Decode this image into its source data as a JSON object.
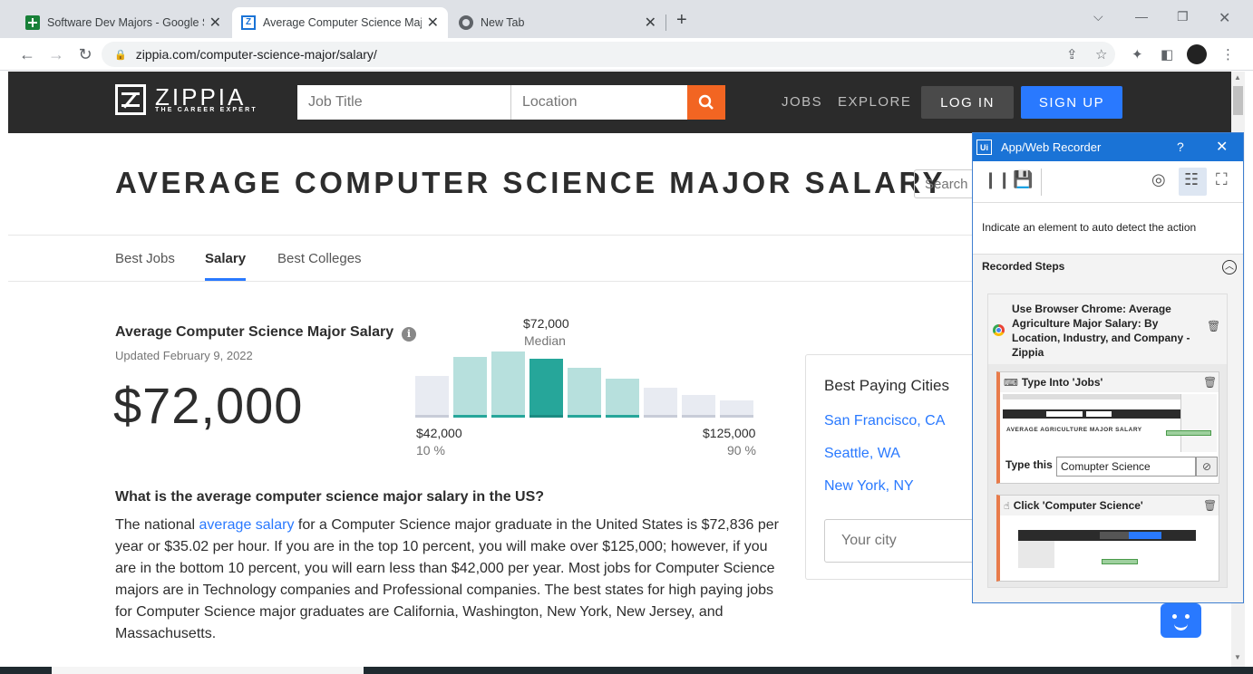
{
  "browser": {
    "tabs": [
      {
        "label": "Software Dev Majors - Google Sh",
        "icon": "sheets-icon"
      },
      {
        "label": "Average Computer Science Majo",
        "icon": "zippia-icon"
      },
      {
        "label": "New Tab",
        "icon": "chrome-icon"
      }
    ],
    "url": "zippia.com/computer-science-major/salary/"
  },
  "zippia": {
    "logo_name": "ZIPPIA",
    "logo_tagline": "THE CAREER EXPERT",
    "job_placeholder": "Job Title",
    "location_placeholder": "Location",
    "nav": [
      "JOBS",
      "EXPLORE"
    ],
    "login": "LOG IN",
    "signup": "SIGN UP",
    "page_title": "AVERAGE COMPUTER SCIENCE MAJOR SALARY",
    "search_placeholder": "Search F",
    "tabs": [
      "Best Jobs",
      "Salary",
      "Best Colleges"
    ],
    "salary_heading": "Average Computer Science Major Salary",
    "updated": "Updated February 9, 2022",
    "big_salary": "$72,000",
    "median_value": "$72,000",
    "median_label": "Median",
    "low_value": "$42,000",
    "low_pct": "10 %",
    "high_value": "$125,000",
    "high_pct": "90 %",
    "question": "What is the average computer science major salary in the US?",
    "para_before": "The national ",
    "para_link": "average salary",
    "para_after": " for a Computer Science major graduate in the United States is $72,836 per year or $35.02 per hour. If you are in the top 10 percent, you will make over $125,000; however, if you are in the bottom 10 percent, you will earn less than $42,000 per year. Most jobs for Computer Science majors are in Technology companies and Professional companies. The best states for high paying jobs for Computer Science major graduates are California, Washington, New York, New Jersey, and Massachusetts.",
    "cities_title": "Best Paying Cities",
    "cities": [
      "San Francisco, CA",
      "Seattle, WA",
      "New York, NY"
    ],
    "city_placeholder": "Your city"
  },
  "histogram": {
    "levels": [
      0.6,
      0.88,
      0.96,
      0.86,
      0.72,
      0.57,
      0.44,
      0.33,
      0.25
    ],
    "styles": [
      "light",
      "mid",
      "mid",
      "main",
      "mid",
      "mid",
      "light",
      "light",
      "light"
    ]
  },
  "recorder": {
    "title": "App/Web Recorder",
    "help": "?",
    "hint": "Indicate an element to auto detect the action",
    "steps_title": "Recorded Steps",
    "scope_label": "Use Browser Chrome: Average Agriculture Major Salary: By Location, Industry, and Company - Zippia",
    "action1_label": "Type Into 'Jobs'",
    "type_label": "Type this",
    "type_value": "Comupter Science",
    "action2_label": "Click 'Computer Science'",
    "thumb1_text": "AVERAGE AGRICULTURE MAJOR SALARY"
  }
}
